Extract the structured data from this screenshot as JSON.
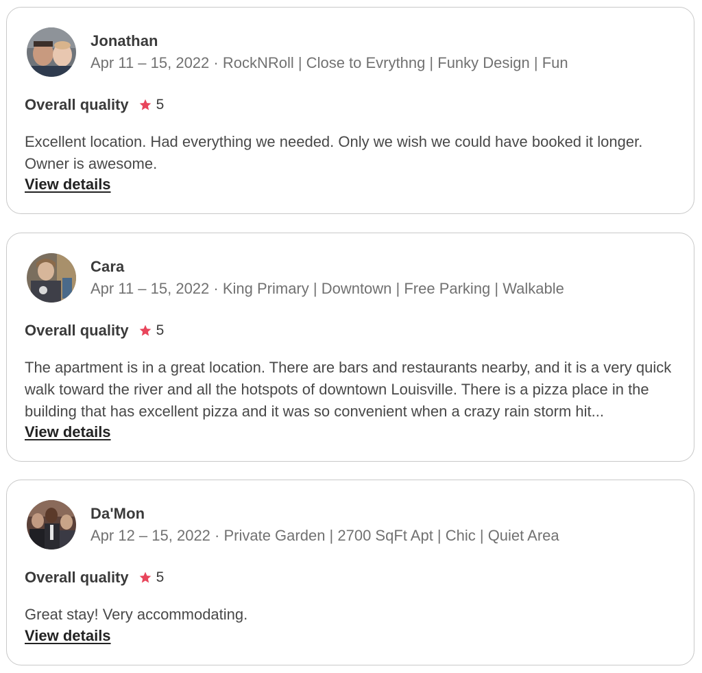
{
  "reviews": [
    {
      "name": "Jonathan",
      "meta": "Apr 11 – 15, 2022 · RockNRoll | Close to Evrythng | Funky Design | Fun",
      "rating_label": "Overall quality",
      "rating_value": "5",
      "text": "Excellent location. Had everything we needed. Only we wish we could have booked it longer. Owner is awesome.",
      "link": "View details"
    },
    {
      "name": "Cara",
      "meta": "Apr 11 – 15, 2022 · King Primary | Downtown | Free Parking | Walkable",
      "rating_label": "Overall quality",
      "rating_value": "5",
      "text": "The apartment is in a great location. There are bars and restaurants nearby, and it is a very quick walk toward the river and all the hotspots of downtown Louisville. There is a pizza place in the building that has excellent pizza and it was so convenient when a crazy rain storm hit...",
      "link": "View details"
    },
    {
      "name": "Da'Mon",
      "meta": "Apr 12 – 15, 2022 · Private Garden | 2700 SqFt Apt | Chic | Quiet Area",
      "rating_label": "Overall quality",
      "rating_value": "5",
      "text": "Great stay! Very accommodating.",
      "link": "View details"
    }
  ],
  "colors": {
    "star": "#e8455b",
    "card_border": "#c8c8c8",
    "meta_text": "#717171"
  },
  "icons": {
    "star": "star-icon",
    "avatar": "user-photo"
  }
}
